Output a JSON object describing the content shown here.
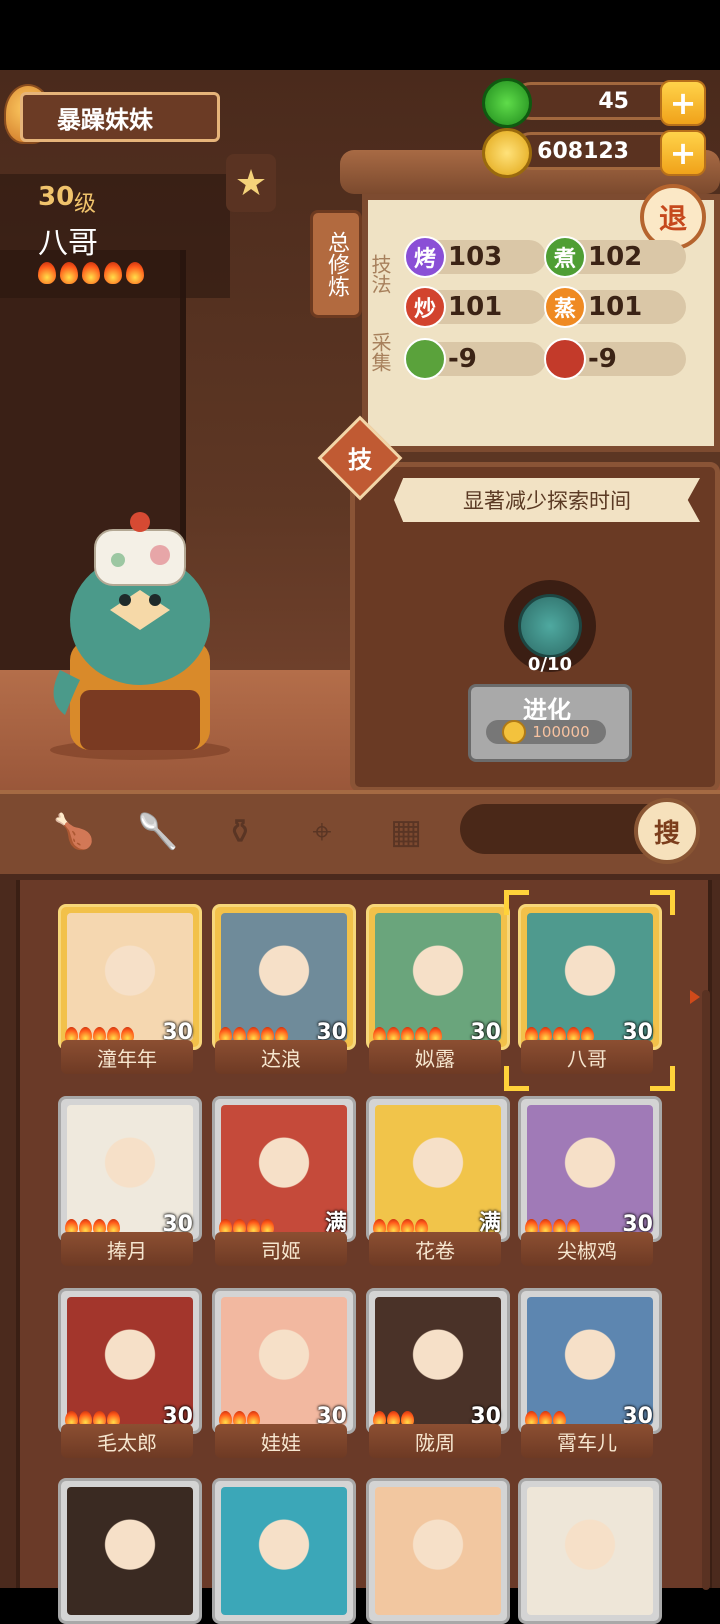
{
  "player": {
    "name": "暴躁妹妹"
  },
  "character": {
    "level": "30",
    "level_unit": "级",
    "name": "八哥",
    "stars": 5
  },
  "currency": {
    "jade": {
      "value": "45",
      "icon": "jade-coin-icon"
    },
    "gold": {
      "value": "608123",
      "icon": "gold-coin-icon"
    }
  },
  "cultivation": {
    "tag": "总修炼",
    "retreat_label": "退",
    "technique_label": "技法",
    "gather_label": "采集",
    "skills": [
      {
        "icon_text": "烤",
        "value": "103",
        "color": "#8a4fd6"
      },
      {
        "icon_text": "煮",
        "value": "102",
        "color": "#4f9e34"
      },
      {
        "icon_text": "炒",
        "value": "101",
        "color": "#d2432e"
      },
      {
        "icon_text": "蒸",
        "value": "101",
        "color": "#ef8a22"
      },
      {
        "icon_text": "",
        "value": "-9",
        "color": "#5aa23b"
      },
      {
        "icon_text": "",
        "value": "-9",
        "color": "#c33a2a"
      }
    ]
  },
  "skill_tag": "技",
  "skill_banner": "显著减少探索时间",
  "evolve": {
    "count": "0/10",
    "label": "进化",
    "cost": "100000"
  },
  "toolbar": {
    "search_label": "搜"
  },
  "roster": [
    {
      "name": "潼年年",
      "level": "30",
      "flames": 5,
      "rarity": "gold",
      "color": "#f5d7b0",
      "selected": false
    },
    {
      "name": "达浪",
      "level": "30",
      "flames": 5,
      "rarity": "gold",
      "color": "#6f8b9a",
      "selected": false
    },
    {
      "name": "姒露",
      "level": "30",
      "flames": 5,
      "rarity": "gold",
      "color": "#6aa57c",
      "selected": false
    },
    {
      "name": "八哥",
      "level": "30",
      "flames": 5,
      "rarity": "gold",
      "color": "#4f9a8e",
      "selected": true
    },
    {
      "name": "捧月",
      "level": "30",
      "flames": 4,
      "rarity": "silver",
      "color": "#efe9dd",
      "selected": false
    },
    {
      "name": "司姬",
      "level": "满",
      "flames": 4,
      "rarity": "silver",
      "color": "#c54a3a",
      "selected": false
    },
    {
      "name": "花卷",
      "level": "满",
      "flames": 4,
      "rarity": "silver",
      "color": "#f1c44a",
      "selected": false
    },
    {
      "name": "尖椒鸡",
      "level": "30",
      "flames": 4,
      "rarity": "silver",
      "color": "#a07ab7",
      "selected": false
    },
    {
      "name": "毛太郎",
      "level": "30",
      "flames": 4,
      "rarity": "silver",
      "color": "#a3362c",
      "selected": false
    },
    {
      "name": "娃娃",
      "level": "30",
      "flames": 3,
      "rarity": "silver",
      "color": "#f2b8a0",
      "selected": false
    },
    {
      "name": "陇周",
      "level": "30",
      "flames": 3,
      "rarity": "silver",
      "color": "#4a3228",
      "selected": false
    },
    {
      "name": "霄车儿",
      "level": "30",
      "flames": 3,
      "rarity": "silver",
      "color": "#5d86b0",
      "selected": false
    },
    {
      "name": "",
      "level": "",
      "flames": 0,
      "rarity": "silver",
      "color": "#3a2a22",
      "selected": false
    },
    {
      "name": "",
      "level": "",
      "flames": 0,
      "rarity": "silver",
      "color": "#3ba7b8",
      "selected": false
    },
    {
      "name": "",
      "level": "",
      "flames": 0,
      "rarity": "silver",
      "color": "#f2c7a0",
      "selected": false
    },
    {
      "name": "",
      "level": "",
      "flames": 0,
      "rarity": "silver",
      "color": "#eee6d8",
      "selected": false
    }
  ]
}
